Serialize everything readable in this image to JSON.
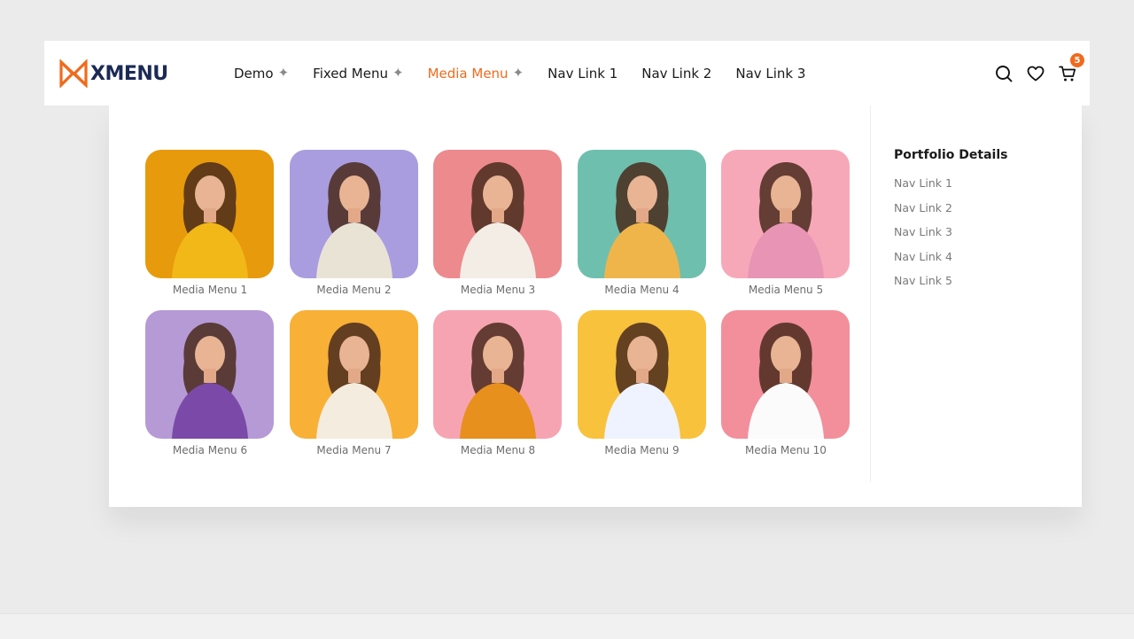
{
  "brand": {
    "name": "XMENU",
    "accent": "#f06a1d",
    "text_color": "#1b2a55"
  },
  "nav": [
    {
      "label": "Demo",
      "has_submenu": true,
      "active": false
    },
    {
      "label": "Fixed Menu",
      "has_submenu": true,
      "active": false
    },
    {
      "label": "Media Menu",
      "has_submenu": true,
      "active": true
    },
    {
      "label": "Nav Link 1",
      "has_submenu": false,
      "active": false
    },
    {
      "label": "Nav Link 2",
      "has_submenu": false,
      "active": false
    },
    {
      "label": "Nav Link 3",
      "has_submenu": false,
      "active": false
    }
  ],
  "header_icons": {
    "search": "search-icon",
    "wishlist": "heart-icon",
    "cart": "cart-icon",
    "cart_count": "5"
  },
  "media_items": [
    {
      "label": "Media Menu 1",
      "bg": "#e79a0b",
      "fig": "#f2b817"
    },
    {
      "label": "Media Menu 2",
      "bg": "#a99ddf",
      "fig": "#e9e3d6"
    },
    {
      "label": "Media Menu 3",
      "bg": "#ec8a8e",
      "fig": "#f3ede6"
    },
    {
      "label": "Media Menu 4",
      "bg": "#6fbfae",
      "fig": "#f0b54a"
    },
    {
      "label": "Media Menu 5",
      "bg": "#f7a8b8",
      "fig": "#e894b4"
    },
    {
      "label": "Media Menu 6",
      "bg": "#b69ad6",
      "fig": "#7b4aa8"
    },
    {
      "label": "Media Menu 7",
      "bg": "#f8b036",
      "fig": "#f4ecdf"
    },
    {
      "label": "Media Menu 8",
      "bg": "#f7a4b2",
      "fig": "#e7901d"
    },
    {
      "label": "Media Menu 9",
      "bg": "#f9c23c",
      "fig": "#eef3ff"
    },
    {
      "label": "Media Menu 10",
      "bg": "#f28f9b",
      "fig": "#fbfbfb"
    }
  ],
  "sidebar": {
    "title": "Portfolio Details",
    "links": [
      "Nav Link 1",
      "Nav Link 2",
      "Nav Link 3",
      "Nav Link 4",
      "Nav Link 5"
    ]
  }
}
